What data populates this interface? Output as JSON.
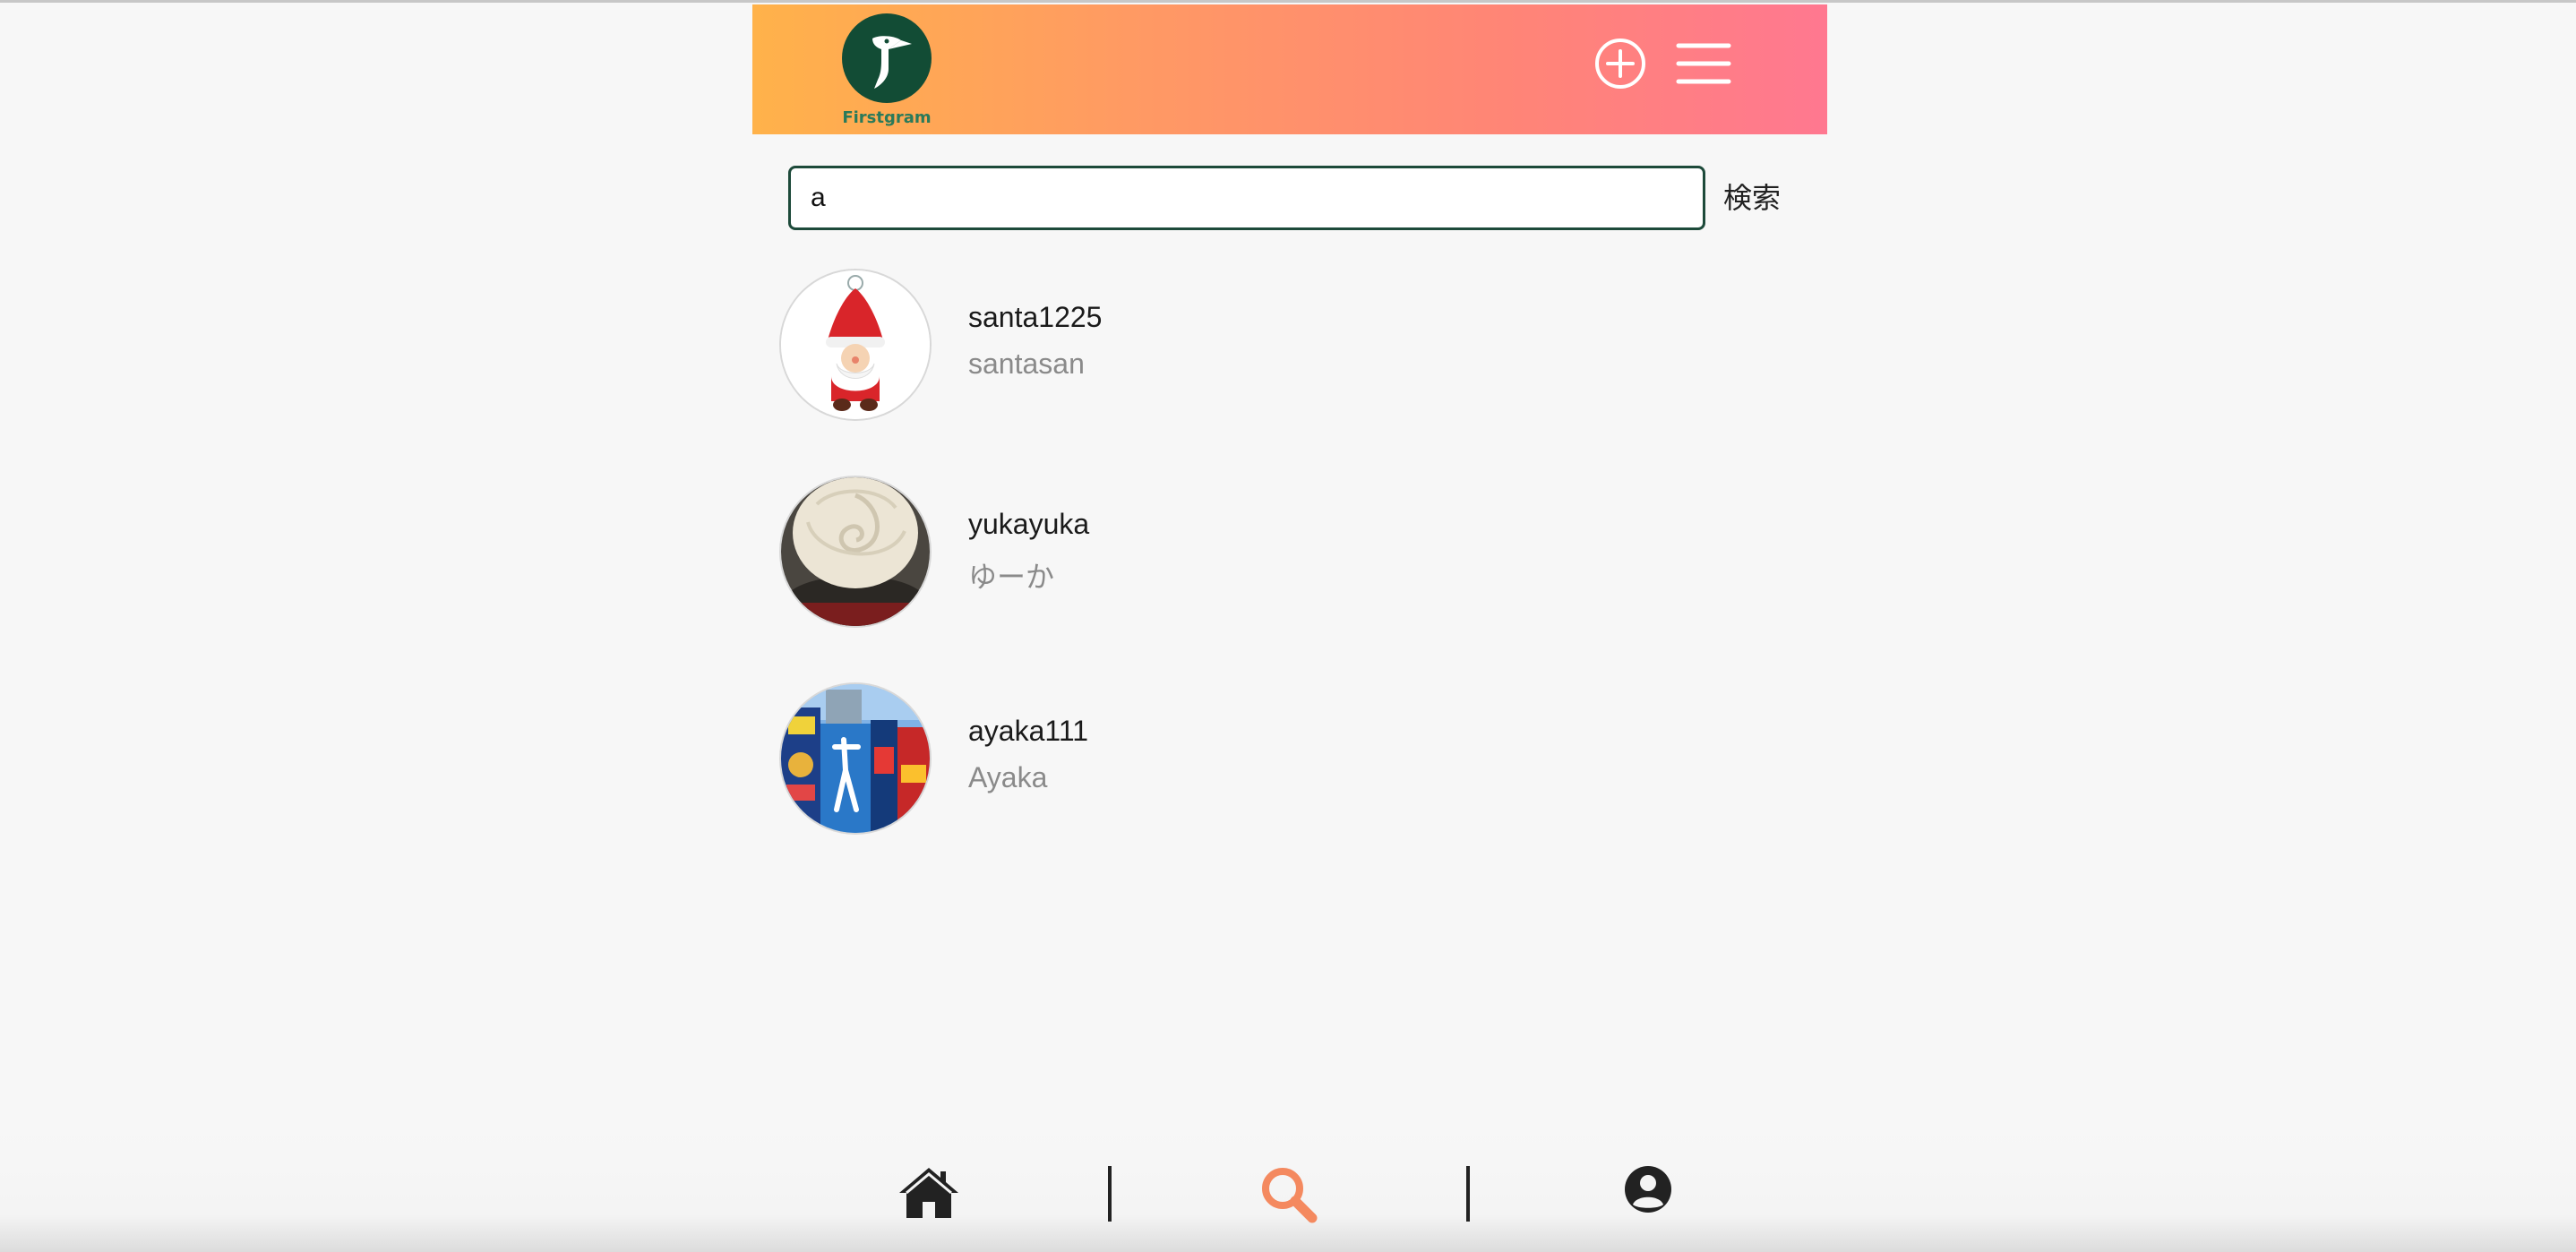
{
  "app": {
    "name": "Firstgram",
    "brand_colors": {
      "gradient_start": "#ffb24a",
      "gradient_end": "#ff7890",
      "logo_bg": "#124c35",
      "active_nav": "#f4895f"
    }
  },
  "header": {
    "logo_text": "Firstgram",
    "add_icon": "plus-circle-icon",
    "menu_icon": "hamburger-menu-icon"
  },
  "search": {
    "value": "a",
    "button_label": "検索"
  },
  "results": [
    {
      "username": "santa1225",
      "display_name": "santasan",
      "avatar": "santa-illustration"
    },
    {
      "username": "yukayuka",
      "display_name": "ゆーか",
      "avatar": "cream-cake-photo"
    },
    {
      "username": "ayaka111",
      "display_name": "Ayaka",
      "avatar": "osaka-glico-sign-photo"
    }
  ],
  "bottom_nav": {
    "items": [
      {
        "icon": "home-icon",
        "active": false
      },
      {
        "icon": "search-icon",
        "active": true
      },
      {
        "icon": "user-circle-icon",
        "active": false
      }
    ]
  }
}
